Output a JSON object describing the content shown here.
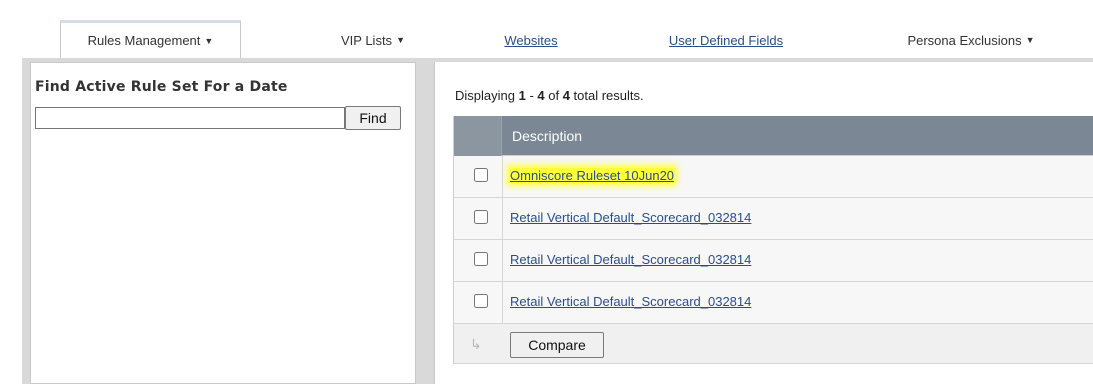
{
  "nav": {
    "tabs": [
      {
        "label": "Rules Management",
        "arrow": "▼",
        "active": true
      },
      {
        "label": "VIP Lists",
        "arrow": "▼"
      },
      {
        "label": "Websites",
        "link": true
      },
      {
        "label": "User Defined Fields",
        "link": true
      },
      {
        "label": "Persona Exclusions",
        "arrow": "▼"
      }
    ]
  },
  "left": {
    "title": "Find Active Rule Set For a Date",
    "date_value": "",
    "find_label": "Find"
  },
  "results": {
    "prefix": "Displaying ",
    "start": "1",
    "dash": " - ",
    "end": "4",
    "of": " of ",
    "total": "4",
    "suffix": " total results."
  },
  "grid": {
    "header": "Description",
    "rows": [
      {
        "description": "Omniscore Ruleset 10Jun20",
        "highlighted": true
      },
      {
        "description": "Retail Vertical Default_Scorecard_032814"
      },
      {
        "description": "Retail Vertical Default_Scorecard_032814"
      },
      {
        "description": "Retail Vertical Default_Scorecard_032814"
      }
    ],
    "compare_label": "Compare",
    "footer_icon": "arrow-corner-icon"
  },
  "colors": {
    "header_bg": "#7b8794",
    "link": "#2a4d8f",
    "highlight": "#ffff3a"
  }
}
